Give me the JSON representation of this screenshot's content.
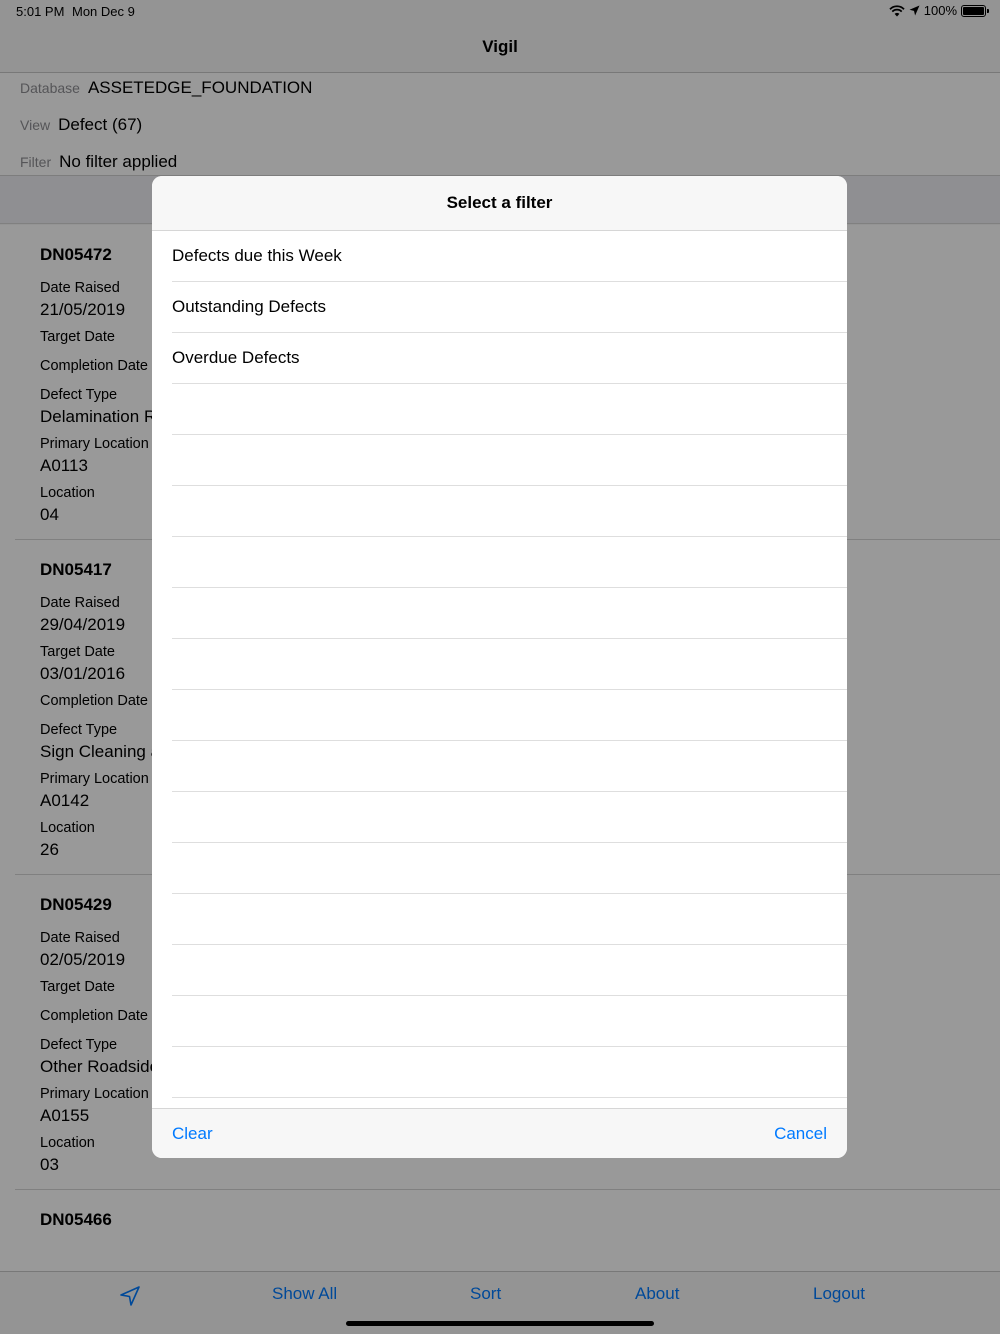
{
  "status": {
    "time": "5:01 PM",
    "date": "Mon Dec 9",
    "battery": "100%"
  },
  "nav": {
    "title": "Vigil"
  },
  "header": {
    "database_label": "Database",
    "database_value": "ASSETEDGE_FOUNDATION",
    "view_label": "View",
    "view_value": "Defect (67)",
    "filter_label": "Filter",
    "filter_value": "No filter applied"
  },
  "labels": {
    "date_raised": "Date Raised",
    "target_date": "Target Date",
    "completion_date": "Completion Date",
    "defect_type": "Defect Type",
    "primary_location": "Primary Location",
    "location": "Location"
  },
  "records": [
    {
      "id": "DN05472",
      "date_raised": "21/05/2019",
      "target_date": "",
      "completion_date": "",
      "defect_type": "Delamination Repa",
      "primary_location": "A0113",
      "location": "04"
    },
    {
      "id": "DN05417",
      "date_raised": "29/04/2019",
      "target_date": "03/01/2016",
      "completion_date": "",
      "defect_type": "Sign Cleaning and",
      "primary_location": "A0142",
      "location": "26"
    },
    {
      "id": "DN05429",
      "date_raised": "02/05/2019",
      "target_date": "",
      "completion_date": "",
      "defect_type": "Other Roadside M",
      "primary_location": "A0155",
      "location": "03"
    },
    {
      "id": "DN05466"
    }
  ],
  "tabs": {
    "show_all": "Show All",
    "sort": "Sort",
    "about": "About",
    "logout": "Logout"
  },
  "modal": {
    "title": "Select a filter",
    "options": [
      "Defects due this Week",
      "Outstanding Defects",
      "Overdue Defects"
    ],
    "clear": "Clear",
    "cancel": "Cancel"
  },
  "colors": {
    "accent": "#007aff",
    "background": "#f7f7f7"
  }
}
